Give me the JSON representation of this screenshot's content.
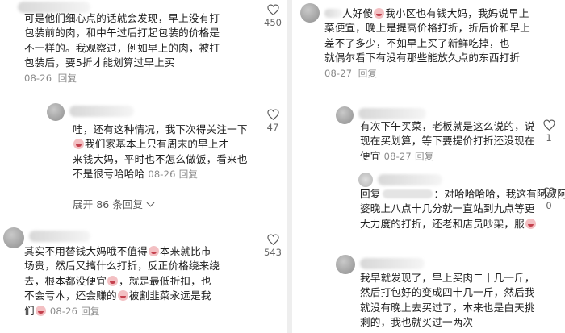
{
  "left": {
    "c1": {
      "lines": [
        "可是他们细心点的话就会发现，早上没有打",
        "包装前的肉，和中午过后打起包装的价格是",
        "不一样的。我观察过，例如早上的肉，被打",
        "包装后，要5折才能划算过早上买"
      ],
      "date": "08-26",
      "reply_label": "回复",
      "likes": "450"
    },
    "c2": {
      "line1": "哇，还有这种情况，我下次得关注一下",
      "line2_rest": "我们家基本上只有周末的早上才",
      "line3": "来钱大妈，平时也不怎么做饭，看来也",
      "line4": "不是很亏哈哈哈",
      "date": "08-26",
      "reply_label": "回复",
      "likes": "47",
      "expand_label": "展开 86 条回复"
    },
    "c3": {
      "line1_a": "其实不用替钱大妈哦不值得",
      "line1_b": "本来就比市",
      "line2": "场贵，然后又搞什么打折，反正价格绕来绕",
      "line3": "去，根本都没便宜",
      "line3_b": "，就是最低折扣，也",
      "line4_a": "不会亏本，还会赚的",
      "line4_b": "被割韭菜永远是我",
      "line5": "们",
      "date": "08-26",
      "reply_label": "回复",
      "likes": "543"
    }
  },
  "right": {
    "r1": {
      "line1_a": "人好傻",
      "line1_b": "我小区也有钱大妈，我妈说早上",
      "line2": "菜便宜，晚上是提高价格打折，折后价和早上",
      "line3": "差不了多少，不如早上买了新鲜吃掉，也",
      "line4": "就偶尔看下有没有那些能放久点的东西打折",
      "date": "08-27",
      "reply_label": "回复"
    },
    "r2": {
      "line1": "有次下午买菜，老板就是这么说的，说",
      "line2": "现在买划算，等下要提价打折还没现在",
      "line3": "便宜",
      "date": "08-27",
      "reply_label": "回复",
      "likes": "1"
    },
    "r3": {
      "prefix": "回复",
      "line1_b": "：对哈哈哈哈，我这有阿叔阿",
      "line2": "婆晚上八点十几分就一直站到九点等更",
      "line3": "大力度的打折，还老和店员吵架，服",
      "likes": "0"
    },
    "r4": {
      "line1": "我早就发现了，早上买肉二十几一斤，",
      "line2": "然后打包好的变成四十几一斤，然后我",
      "line3": "就没有晚上去买过了，本来也是白天挑",
      "line4": "剩的，我也就买过一两次"
    }
  },
  "colors": {
    "text": "#1f1f1f",
    "meta": "#8a8a8a",
    "divider": "#eeeeee"
  }
}
